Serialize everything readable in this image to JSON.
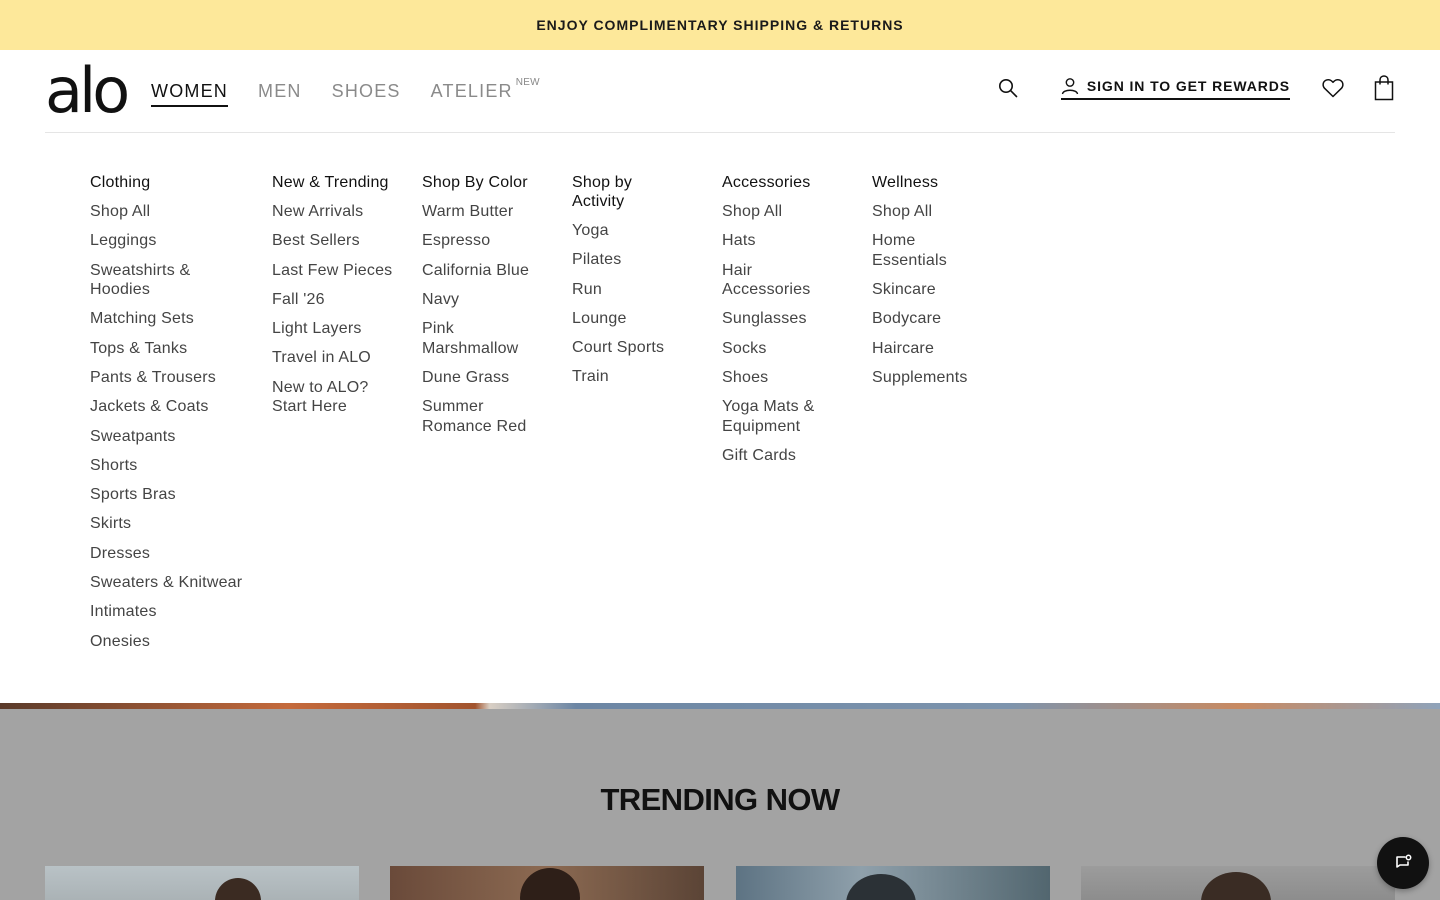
{
  "promo": {
    "text": "ENJOY COMPLIMENTARY SHIPPING & RETURNS"
  },
  "header": {
    "logo": "alo",
    "nav": [
      {
        "label": "WOMEN",
        "active": true
      },
      {
        "label": "MEN",
        "active": false
      },
      {
        "label": "SHOES",
        "active": false
      },
      {
        "label": "ATELIER",
        "active": false,
        "badge": "NEW"
      }
    ],
    "signin_label": "SIGN IN TO GET REWARDS"
  },
  "menu": {
    "columns": [
      {
        "title": "Clothing",
        "items": [
          "Shop All",
          "Leggings",
          "Sweatshirts & Hoodies",
          "Matching Sets",
          "Tops & Tanks",
          "Pants & Trousers",
          "Jackets & Coats",
          "Sweatpants",
          "Shorts",
          "Sports Bras",
          "Skirts",
          "Dresses",
          "Sweaters & Knitwear",
          "Intimates",
          "Onesies"
        ]
      },
      {
        "title": "New & Trending",
        "items": [
          "New Arrivals",
          "Best Sellers",
          "Last Few Pieces",
          "Fall '26",
          "Light Layers",
          "Travel in ALO",
          "New to ALO? Start Here"
        ]
      },
      {
        "title": "Shop By Color",
        "items": [
          "Warm Butter",
          "Espresso",
          "California Blue",
          "Navy",
          "Pink Marshmallow",
          "Dune Grass",
          "Summer Romance Red"
        ]
      },
      {
        "title": "Shop by Activity",
        "items": [
          "Yoga",
          "Pilates",
          "Run",
          "Lounge",
          "Court Sports",
          "Train"
        ]
      },
      {
        "title": "Accessories",
        "items": [
          "Shop All",
          "Hats",
          "Hair Accessories",
          "Sunglasses",
          "Socks",
          "Shoes",
          "Yoga Mats & Equipment",
          "Gift Cards"
        ]
      },
      {
        "title": "Wellness",
        "items": [
          "Shop All",
          "Home Essentials",
          "Skincare",
          "Bodycare",
          "Haircare",
          "Supplements"
        ]
      }
    ]
  },
  "trending": {
    "title": "TRENDING NOW"
  },
  "colors": {
    "promo_bg": "#fde89a",
    "overlay": "#a3a3a3",
    "text": "#111111"
  },
  "icons": [
    "search-icon",
    "user-icon",
    "heart-icon",
    "shopping-bag-icon",
    "chat-icon"
  ]
}
